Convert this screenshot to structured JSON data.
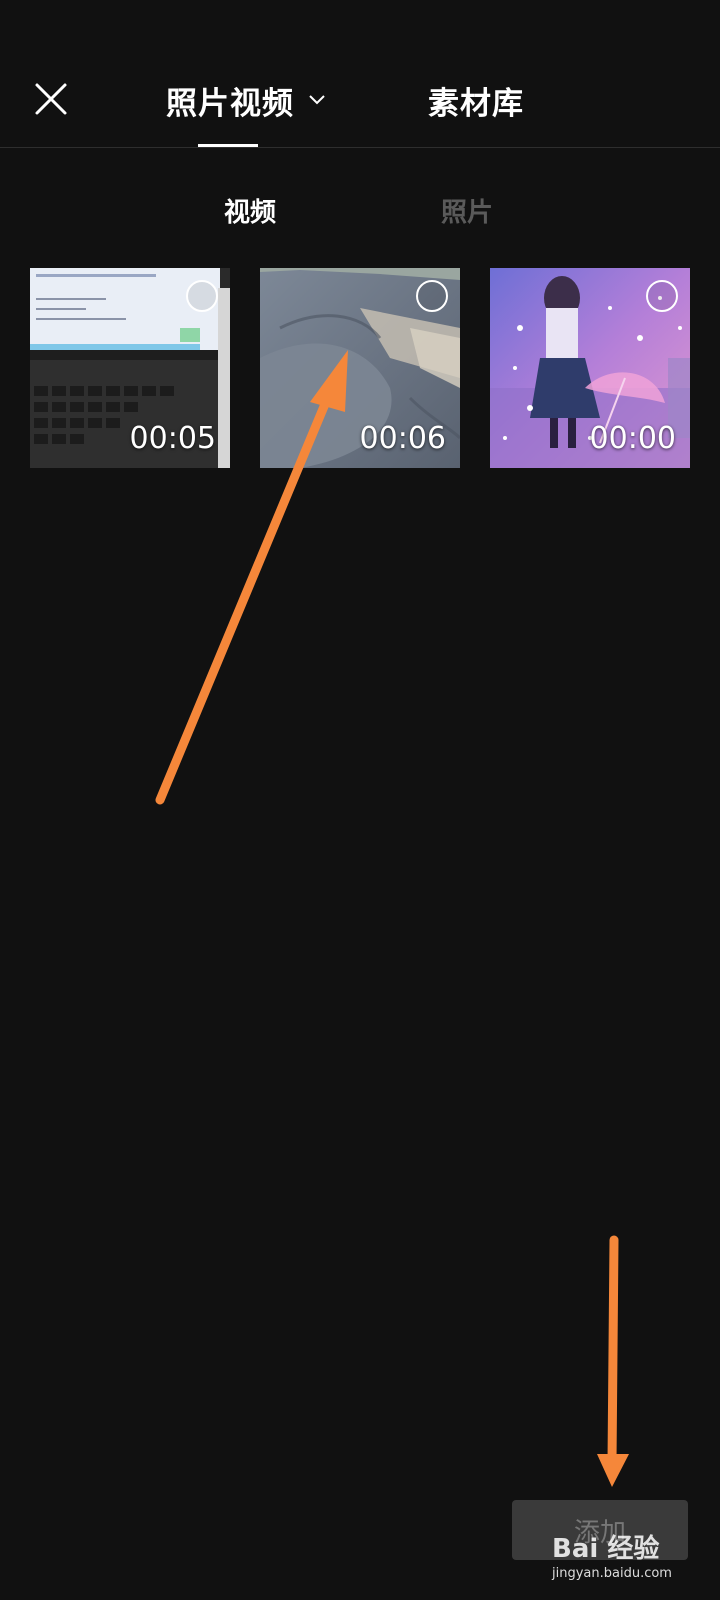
{
  "header": {
    "tab_main_label": "照片视频",
    "tab_library_label": "素材库"
  },
  "subtabs": {
    "video_label": "视频",
    "photo_label": "照片"
  },
  "media": [
    {
      "duration": "00:05",
      "thumbnail": "laptop screen"
    },
    {
      "duration": "00:06",
      "thumbnail": "grey fabric"
    },
    {
      "duration": "00:00",
      "thumbnail": "anime girl with umbrella"
    }
  ],
  "footer": {
    "add_label": "添加"
  },
  "watermark": {
    "brand": "Bai 经验",
    "url": "jingyan.baidu.com"
  },
  "colors": {
    "background": "#111111",
    "annotation_arrow": "#F5873A",
    "inactive_tab": "#5a5a5a"
  }
}
